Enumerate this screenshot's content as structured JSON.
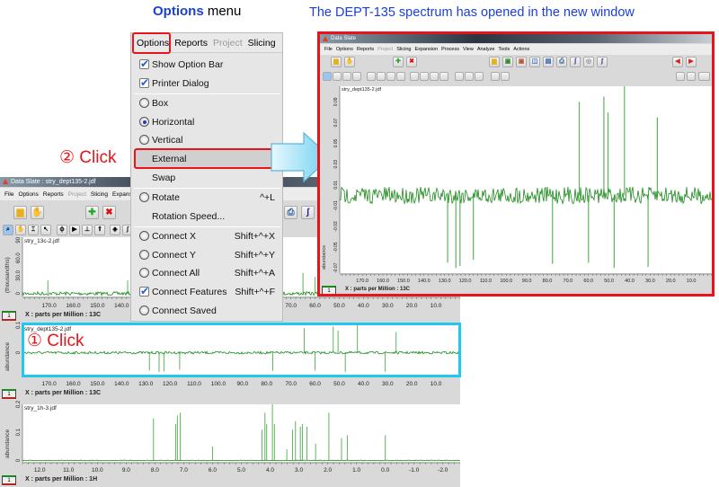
{
  "headings": {
    "options_bold": "Options",
    "options_rest": " menu",
    "right": "The DEPT-135 spectrum has opened in the new window"
  },
  "annotations": {
    "step1": "① Click",
    "step2": "② Click"
  },
  "colors": {
    "heading_blue": "#1a3fd8",
    "annotation_red": "#e8141a",
    "highlight_cyan": "#1ec8f0",
    "spectrum_green": "#1a8a1a"
  },
  "options_menu": {
    "menubar": [
      {
        "label": "Options",
        "disabled": false
      },
      {
        "label": "Reports",
        "disabled": false
      },
      {
        "label": "Project",
        "disabled": true
      },
      {
        "label": "Slicing",
        "disabled": false
      }
    ],
    "items": [
      {
        "label": "Show Option Bar",
        "type": "check",
        "checked": true,
        "shortcut": ""
      },
      {
        "label": "Printer Dialog",
        "type": "check",
        "checked": true,
        "shortcut": "",
        "sep_after": true
      },
      {
        "label": "Box",
        "type": "radio",
        "checked": false,
        "shortcut": ""
      },
      {
        "label": "Horizontal",
        "type": "radio",
        "checked": true,
        "shortcut": ""
      },
      {
        "label": "Vertical",
        "type": "radio",
        "checked": false,
        "shortcut": ""
      },
      {
        "label": "External",
        "type": "none",
        "checked": false,
        "shortcut": "",
        "highlighted": true
      },
      {
        "label": "Swap",
        "type": "none",
        "checked": false,
        "shortcut": "",
        "sep_after": true
      },
      {
        "label": "Rotate",
        "type": "radio",
        "checked": false,
        "shortcut": "^+L"
      },
      {
        "label": "Rotation Speed...",
        "type": "none",
        "checked": false,
        "shortcut": "",
        "sep_after": true
      },
      {
        "label": "Connect X",
        "type": "radio",
        "checked": false,
        "shortcut": "Shift+^+X"
      },
      {
        "label": "Connect Y",
        "type": "radio",
        "checked": false,
        "shortcut": "Shift+^+Y"
      },
      {
        "label": "Connect All",
        "type": "radio",
        "checked": false,
        "shortcut": "Shift+^+A"
      },
      {
        "label": "Connect Features",
        "type": "check",
        "checked": true,
        "shortcut": "Shift+^+F"
      },
      {
        "label": "Connect Saved",
        "type": "radio",
        "checked": false,
        "shortcut": ""
      }
    ]
  },
  "left_window": {
    "title": "Data Slate : stry_dept135-2.jdf",
    "menu": [
      {
        "label": "File"
      },
      {
        "label": "Options"
      },
      {
        "label": "Reports"
      },
      {
        "label": "Project",
        "disabled": true
      },
      {
        "label": "Slicing"
      },
      {
        "label": "Expansion"
      }
    ],
    "plots": [
      {
        "file": "stry_13c-2.jdf",
        "ylabel": "(thousandths)",
        "yticks": [
          "90",
          "60.0",
          "30.0",
          "0"
        ],
        "xlabel": "X : parts per Million : 13C",
        "tag": "1",
        "xrange": [
          181,
          0
        ],
        "xticks": [
          170,
          160,
          150,
          140,
          130,
          120,
          110,
          100,
          90,
          80,
          70,
          60,
          50,
          40,
          30,
          20,
          10
        ],
        "yrange": [
          -5,
          95
        ],
        "peaks": [
          [
            170.5,
            22
          ],
          [
            137.5,
            22
          ],
          [
            128.5,
            30
          ],
          [
            65,
            35
          ],
          [
            60,
            28
          ],
          [
            52.5,
            40
          ],
          [
            50.5,
            30
          ],
          [
            42.5,
            45
          ],
          [
            31,
            30
          ],
          [
            26.5,
            25
          ]
        ]
      },
      {
        "file": "stry_dept135-2.jdf",
        "ylabel": "abundance",
        "yticks": [
          "0.1",
          "0"
        ],
        "xlabel": "X : parts per Million : 13C",
        "tag": "1",
        "xrange": [
          181,
          0
        ],
        "xticks": [
          170,
          160,
          150,
          140,
          130,
          120,
          110,
          100,
          90,
          80,
          70,
          60,
          50,
          40,
          30,
          20,
          10
        ],
        "yrange": [
          -0.08,
          0.1
        ],
        "peaks": [
          [
            64.5,
            0.09
          ],
          [
            52.5,
            0.095
          ],
          [
            50.5,
            0.08
          ],
          [
            42.5,
            0.1
          ],
          [
            26.5,
            0.075
          ],
          [
            128.5,
            -0.065
          ],
          [
            124.5,
            -0.07
          ],
          [
            122.5,
            -0.068
          ],
          [
            116,
            -0.062
          ],
          [
            77.5,
            -0.066
          ],
          [
            60,
            -0.065
          ],
          [
            47.5,
            -0.07
          ],
          [
            31,
            -0.069
          ]
        ]
      },
      {
        "file": "stry_1h-3.jdf",
        "ylabel": "abundance",
        "yticks": [
          "0.2",
          "0.1",
          "0"
        ],
        "xlabel": "X : parts per Million : 1H",
        "tag": "1",
        "xrange": [
          12.6,
          -2.6
        ],
        "xticks": [
          12,
          11,
          10,
          9,
          8,
          7,
          6,
          5,
          4,
          3,
          2,
          1,
          0,
          -1,
          -2
        ],
        "yrange": [
          -0.005,
          0.2
        ],
        "peaks": [
          [
            8.05,
            0.15
          ],
          [
            7.28,
            0.13
          ],
          [
            7.22,
            0.16
          ],
          [
            7.12,
            0.17
          ],
          [
            6.0,
            0.05
          ],
          [
            4.28,
            0.11
          ],
          [
            4.18,
            0.17
          ],
          [
            4.12,
            0.13
          ],
          [
            3.92,
            0.2
          ],
          [
            3.85,
            0.13
          ],
          [
            3.42,
            0.04
          ],
          [
            3.22,
            0.11
          ],
          [
            3.12,
            0.14
          ],
          [
            2.95,
            0.12
          ],
          [
            2.88,
            0.13
          ],
          [
            2.72,
            0.12
          ],
          [
            2.42,
            0.06
          ],
          [
            1.96,
            0.17
          ],
          [
            1.52,
            0.08
          ],
          [
            1.32,
            0.09
          ],
          [
            0.0,
            0.09
          ]
        ]
      }
    ]
  },
  "right_window": {
    "title": "Data Slate",
    "menu": [
      {
        "label": "File"
      },
      {
        "label": "Options"
      },
      {
        "label": "Reports"
      },
      {
        "label": "Project",
        "disabled": true
      },
      {
        "label": "Slicing"
      },
      {
        "label": "Expansion"
      },
      {
        "label": "Process"
      },
      {
        "label": "View"
      },
      {
        "label": "Analyze"
      },
      {
        "label": "Tools"
      },
      {
        "label": "Actions"
      }
    ],
    "plot": {
      "file": "stry_dept135-2.jdf",
      "ylabel": "abundance",
      "yticks": [
        "0.09",
        "0.07",
        "0.05",
        "0.03",
        "0.01",
        "-0.01",
        "-0.03",
        "-0.05",
        "-0.07"
      ],
      "xlabel": "X : parts per Million : 13C",
      "tag": "1",
      "xrange": [
        181,
        0
      ],
      "xticks": [
        170,
        160,
        150,
        140,
        130,
        120,
        110,
        100,
        90,
        80,
        70,
        60,
        50,
        40,
        30,
        20,
        10
      ],
      "yrange": [
        -0.075,
        0.105
      ],
      "peaks": [
        [
          64.5,
          0.09
        ],
        [
          52.5,
          0.095
        ],
        [
          50.5,
          0.08
        ],
        [
          42.5,
          0.105
        ],
        [
          26.5,
          0.075
        ],
        [
          128.5,
          -0.065
        ],
        [
          124.5,
          -0.07
        ],
        [
          122.5,
          -0.068
        ],
        [
          116,
          -0.062
        ],
        [
          77.5,
          -0.066
        ],
        [
          60,
          -0.065
        ],
        [
          47.5,
          -0.07
        ],
        [
          31,
          -0.069
        ]
      ]
    }
  }
}
